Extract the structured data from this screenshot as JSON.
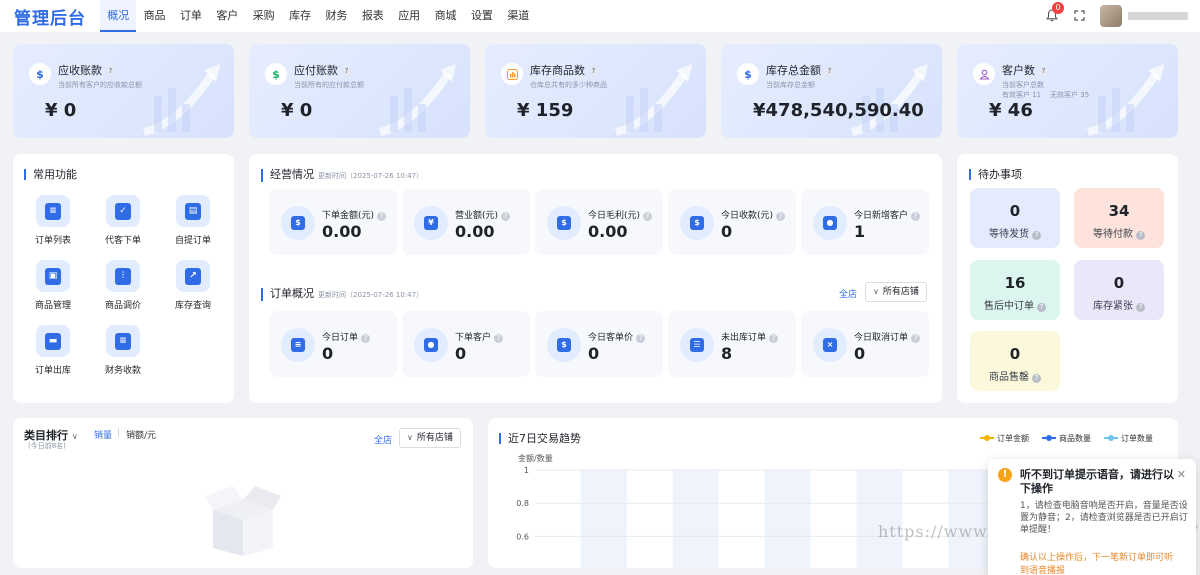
{
  "app": {
    "logo": "管理后台"
  },
  "nav": [
    "概况",
    "商品",
    "订单",
    "客户",
    "采购",
    "库存",
    "财务",
    "报表",
    "应用",
    "商城",
    "设置",
    "渠道"
  ],
  "header": {
    "notification_count": "0"
  },
  "stats": [
    {
      "title": "应收账款",
      "desc": "当前所有客户的应收款总额",
      "value": "¥ 0",
      "icon": "dollar-icon",
      "color": "#2f6ce5"
    },
    {
      "title": "应付账款",
      "desc": "当前所有的应付款总额",
      "value": "¥ 0",
      "icon": "dollar-icon",
      "color": "#1bb46b"
    },
    {
      "title": "库存商品数",
      "desc": "仓库总共有的多少种商品",
      "value": "¥ 159",
      "icon": "chart-icon",
      "color": "#f29d38"
    },
    {
      "title": "库存总金额",
      "desc": "当前库存总金额",
      "value": "¥478,540,590.40",
      "icon": "dollar-icon",
      "color": "#2f6ce5"
    },
    {
      "title": "客户数",
      "desc": "当前客户总数",
      "desc2": "有效客户 11    无效客户 35",
      "value": "¥ 46",
      "icon": "user-icon",
      "color": "#9b59d0"
    }
  ],
  "common": {
    "title": "常用功能",
    "items": [
      "订单列表",
      "代客下单",
      "自提订单",
      "商品管理",
      "商品调价",
      "库存查询",
      "订单出库",
      "财务收款"
    ]
  },
  "business": {
    "title": "经营情况",
    "updated": "更新时间（2025-07-26 10:47）",
    "metrics": [
      {
        "label": "下单金额(元)",
        "value": "0.00"
      },
      {
        "label": "营业额(元)",
        "value": "0.00"
      },
      {
        "label": "今日毛利(元)",
        "value": "0.00"
      },
      {
        "label": "今日收款(元)",
        "value": "0"
      },
      {
        "label": "今日新增客户",
        "value": "1"
      }
    ]
  },
  "orders": {
    "title": "订单概况",
    "updated": "更新时间（2025-07-26 10:47）",
    "all_store": "全店",
    "shop_select": "所有店铺",
    "metrics": [
      {
        "label": "今日订单",
        "value": "0"
      },
      {
        "label": "下单客户",
        "value": "0"
      },
      {
        "label": "今日客单价",
        "value": "0"
      },
      {
        "label": "未出库订单",
        "value": "8"
      },
      {
        "label": "今日取消订单",
        "value": "0"
      }
    ]
  },
  "todo": {
    "title": "待办事项",
    "items": [
      {
        "value": "0",
        "label": "等待发货",
        "bg": "#e3ebfd"
      },
      {
        "value": "34",
        "label": "等待付款",
        "bg": "#fde3dc"
      },
      {
        "value": "16",
        "label": "售后中订单",
        "bg": "#dcf5ee"
      },
      {
        "value": "0",
        "label": "库存紧张",
        "bg": "#ece6fb"
      },
      {
        "value": "0",
        "label": "商品售罄",
        "bg": "#fbf8dc"
      }
    ]
  },
  "category": {
    "title": "类目排行",
    "subtitle": "(今日前8名)",
    "tab_qty": "销量",
    "tab_amount": "销额/元",
    "all_store": "全店",
    "shop_select": "所有店铺"
  },
  "trend": {
    "title": "近7日交易趋势",
    "yaxis_title": "金额/数量",
    "legend": [
      {
        "name": "订单金额",
        "color": "#f5b400"
      },
      {
        "name": "商品数量",
        "color": "#2f6ce5"
      },
      {
        "name": "订单数量",
        "color": "#6fc3f0"
      }
    ]
  },
  "chart_data": {
    "type": "line",
    "title": "近7日交易趋势",
    "ylabel": "金额/数量",
    "yticks": [
      "1",
      "0.8",
      "0.6"
    ],
    "ylim": [
      0,
      1
    ],
    "series": [
      {
        "name": "订单金额",
        "values": []
      },
      {
        "name": "商品数量",
        "values": []
      },
      {
        "name": "订单数量",
        "values": []
      }
    ],
    "legend_position": "top-right",
    "grid": true
  },
  "notice": {
    "title": "听不到订单提示语音，请进行以下操作",
    "body": "1，请检查电脑音响是否开启，音量是否设置为静音；2，请检查浏览器是否已开启订单提醒！",
    "footer": "确认以上操作后，下一笔新订单即可听到语音播报"
  },
  "watermark": "https://www.huzhan.com/ishop58976"
}
